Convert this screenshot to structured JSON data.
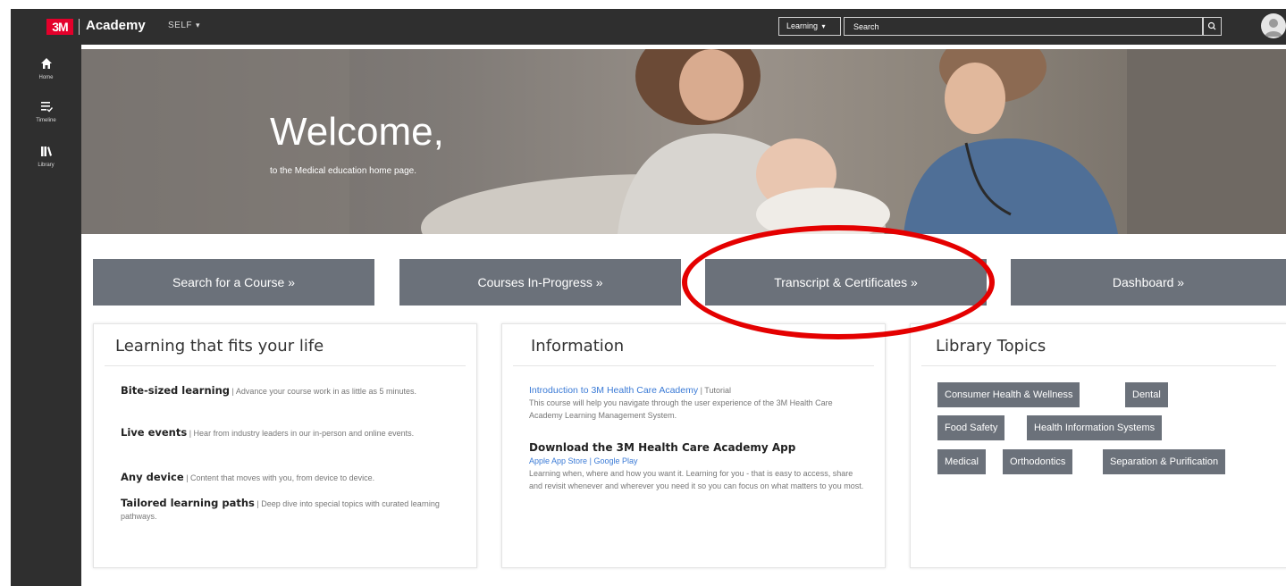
{
  "header": {
    "brand_logo": "3M",
    "brand_name": "Academy",
    "tenant_menu": "SELF",
    "search_scope": "Learning",
    "search_placeholder": "Search"
  },
  "leftnav": {
    "items": [
      {
        "label": "Home",
        "icon": "home-icon"
      },
      {
        "label": "Timeline",
        "icon": "timeline-icon"
      },
      {
        "label": "Library",
        "icon": "library-icon"
      }
    ]
  },
  "hero": {
    "title": "Welcome,",
    "subtitle": "to the Medical education home page."
  },
  "actions": [
    {
      "label": "Search for a Course »"
    },
    {
      "label": "Courses In-Progress »"
    },
    {
      "label": "Transcript & Certificates »"
    },
    {
      "label": "Dashboard »"
    }
  ],
  "learning_card": {
    "title": "Learning that fits your life",
    "items": [
      {
        "heading": "Bite-sized learning",
        "text": "| Advance your course work in as little as 5 minutes."
      },
      {
        "heading": "Live events",
        "text": "| Hear from industry leaders in our in-person and online events."
      },
      {
        "heading": "Any device",
        "text": "| Content that moves with you, from device to device."
      },
      {
        "heading": "Tailored learning paths",
        "text": "| Deep dive into special topics with curated learning pathways."
      }
    ]
  },
  "info_card": {
    "title": "Information",
    "intro_link": "Introduction to 3M Health Care Academy",
    "intro_tag": "| Tutorial",
    "intro_text": "This course will help you navigate through the user experience of the 3M Health Care Academy Learning Management System.",
    "app_heading": "Download the 3M Health Care Academy App",
    "app_store": "Apple App Store",
    "store_sep": "|",
    "play_store": "Google Play",
    "app_text": "Learning when, where and how you want it. Learning for you - that is easy to access, share and revisit whenever and wherever you need it so you can focus on what matters to you most."
  },
  "library_card": {
    "title": "Library Topics",
    "topics": [
      "Consumer Health & Wellness",
      "Dental",
      "Food Safety",
      "Health Information Systems",
      "Medical",
      "Orthodontics",
      "Separation & Purification"
    ]
  },
  "colors": {
    "topbar": "#2f2f2f",
    "brand_red": "#e4002b",
    "button_gray": "#6b717a",
    "link_blue": "#3a7ad6",
    "annotation_red": "#e40000"
  }
}
